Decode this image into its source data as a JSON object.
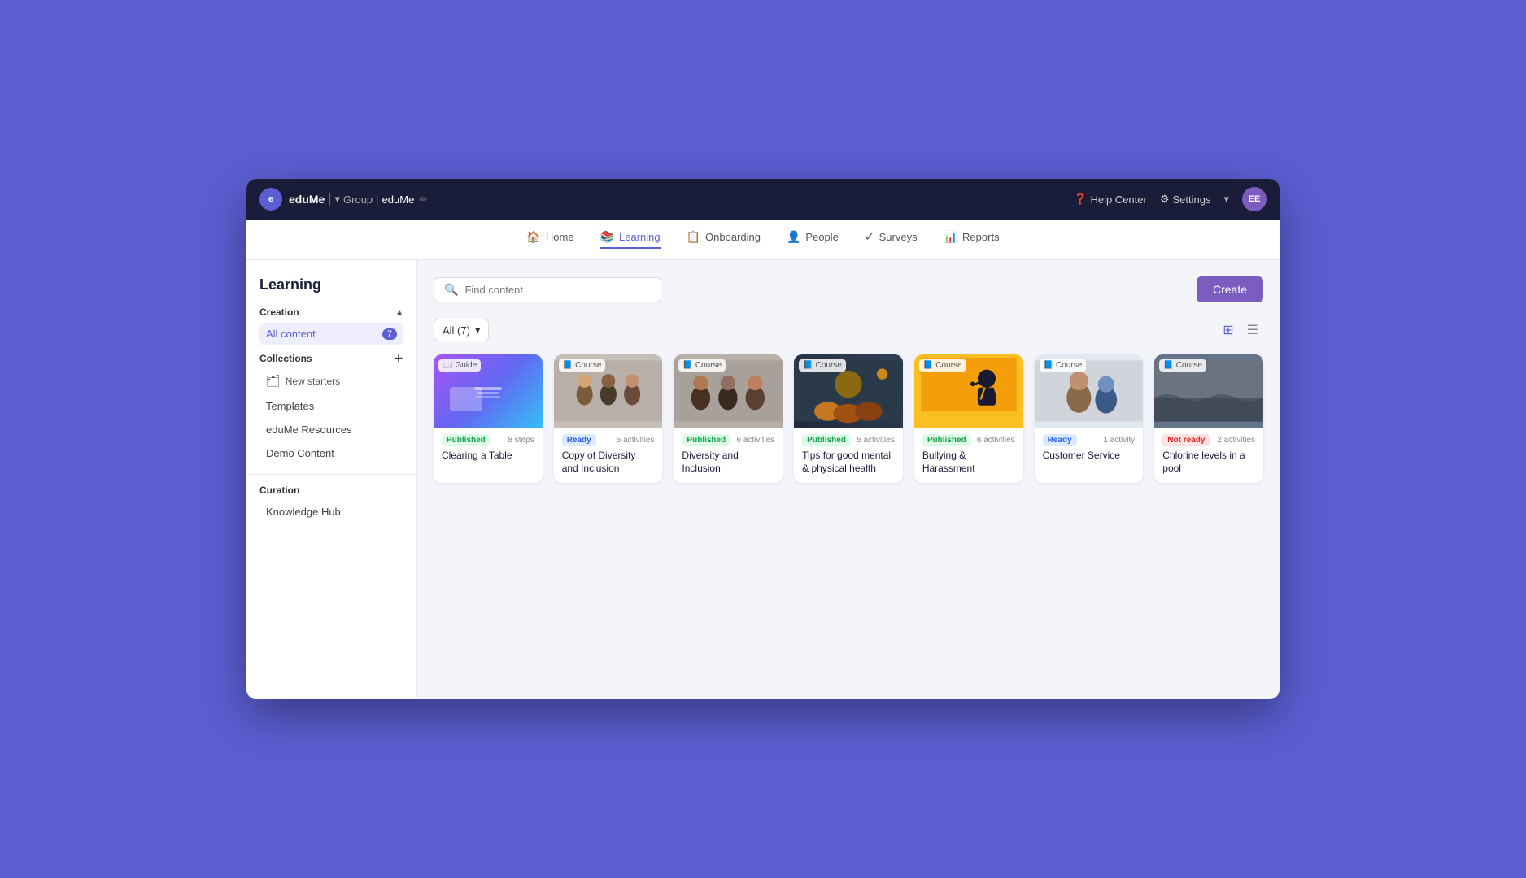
{
  "app": {
    "name": "eduMe",
    "group": "Group",
    "workspace": "eduMe"
  },
  "topNav": {
    "help_label": "Help Center",
    "settings_label": "Settings",
    "user_initials": "EE"
  },
  "secondaryNav": {
    "tabs": [
      {
        "id": "home",
        "label": "Home",
        "icon": "🏠",
        "active": false
      },
      {
        "id": "learning",
        "label": "Learning",
        "icon": "📚",
        "active": true
      },
      {
        "id": "onboarding",
        "label": "Onboarding",
        "icon": "📋",
        "active": false
      },
      {
        "id": "people",
        "label": "People",
        "icon": "👤",
        "active": false
      },
      {
        "id": "surveys",
        "label": "Surveys",
        "icon": "✓",
        "active": false
      },
      {
        "id": "reports",
        "label": "Reports",
        "icon": "📊",
        "active": false
      }
    ]
  },
  "sidebar": {
    "title": "Learning",
    "creation_section": "Creation",
    "collections_section": "Collections",
    "all_content_label": "All content",
    "all_content_count": "7",
    "new_starters_label": "New starters",
    "templates_label": "Templates",
    "edume_resources_label": "eduMe Resources",
    "demo_content_label": "Demo Content",
    "curation_section": "Curation",
    "knowledge_hub_label": "Knowledge Hub"
  },
  "toolbar": {
    "search_placeholder": "Find content",
    "filter_label": "All (7)",
    "create_label": "Create"
  },
  "cards": [
    {
      "id": 1,
      "title": "Clearing a Table",
      "type": "Guide",
      "status": "Published",
      "status_type": "published",
      "count": "8 steps",
      "thumb_style": "clearing"
    },
    {
      "id": 2,
      "title": "Copy of Diversity and Inclusion",
      "type": "Course",
      "status": "Ready",
      "status_type": "ready",
      "count": "5 activities",
      "thumb_style": "people-group"
    },
    {
      "id": 3,
      "title": "Diversity and Inclusion",
      "type": "Course",
      "status": "Published",
      "status_type": "published",
      "count": "6 activities",
      "thumb_style": "people-group2"
    },
    {
      "id": 4,
      "title": "Tips for good mental & physical health",
      "type": "Course",
      "status": "Published",
      "status_type": "published",
      "count": "5 activities",
      "thumb_style": "mental"
    },
    {
      "id": 5,
      "title": "Bullying & Harassment",
      "type": "Course",
      "status": "Published",
      "status_type": "published",
      "count": "6 activities",
      "thumb_style": "bullying"
    },
    {
      "id": 6,
      "title": "Customer Service",
      "type": "Course",
      "status": "Ready",
      "status_type": "ready",
      "count": "1 activity",
      "thumb_style": "customer"
    },
    {
      "id": 7,
      "title": "Chlorine levels in a pool",
      "type": "Course",
      "status": "Not ready",
      "status_type": "not-ready",
      "count": "2 activities",
      "thumb_style": "chlorine"
    }
  ]
}
